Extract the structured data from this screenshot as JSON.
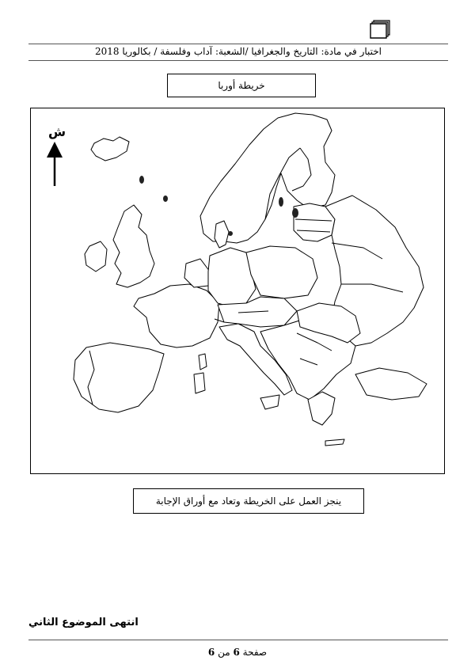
{
  "header": {
    "exam_line": "اختبار في مادة: التاريخ والجغرافيا /الشعبة: آداب وفلسفة / بكالوريا 2018"
  },
  "map": {
    "title": "خريطة أوربا",
    "north_label": "ش",
    "instruction": "ينجز العمل على الخريطة وتعاد مع أوراق الإجابة"
  },
  "end_text": "انتهى الموضوع الثاني",
  "footer": {
    "page_word": "صفحة",
    "page_number": "6",
    "of_word": "من",
    "total_pages": "6"
  }
}
